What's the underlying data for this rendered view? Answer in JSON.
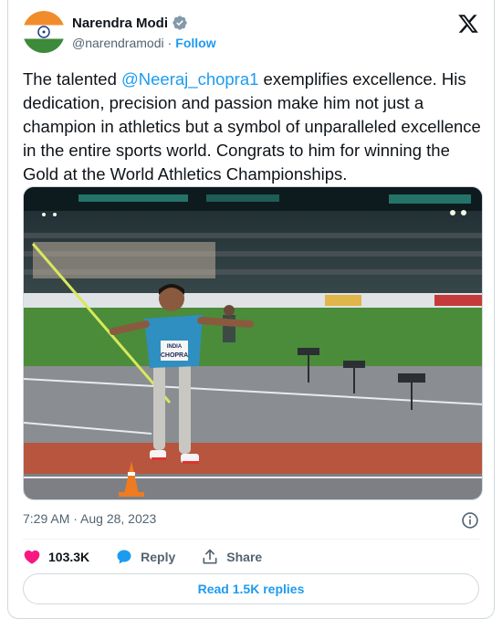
{
  "author": {
    "display_name": "Narendra Modi",
    "handle": "@narendramodi",
    "separator": "·",
    "follow_label": "Follow"
  },
  "tweet": {
    "text_before": "The talented ",
    "mention": "@Neeraj_chopra1",
    "text_after": " exemplifies excellence. His dedication, precision and passion make him not just a champion in athletics but a symbol of unparalleled excellence in the entire sports world. Congrats to him for winning the Gold at the World Athletics Championships."
  },
  "photo": {
    "bib_top": "INDIA",
    "bib_name": "CHOPRA"
  },
  "meta": {
    "timestamp": "7:29 AM · Aug 28, 2023"
  },
  "actions": {
    "likes": "103.3K",
    "reply_label": "Reply",
    "share_label": "Share"
  },
  "footer": {
    "read_replies_label": "Read 1.5K replies"
  },
  "colors": {
    "accent": "#1d9bf0",
    "like": "#f91880",
    "muted": "#536471"
  }
}
